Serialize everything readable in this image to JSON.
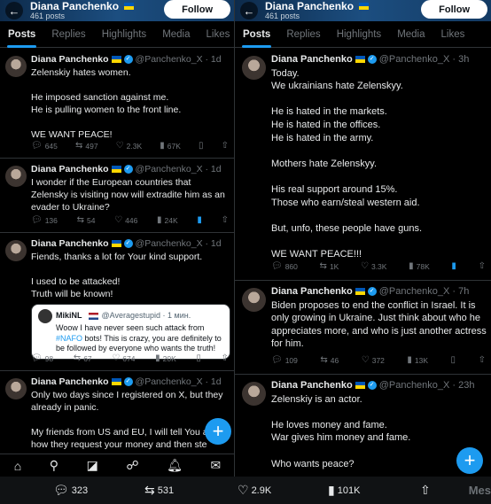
{
  "left": {
    "header": {
      "name": "Diana Panchenko",
      "posts": "461 posts",
      "follow": "Follow"
    },
    "tabs": [
      "Posts",
      "Replies",
      "Highlights",
      "Media",
      "Likes"
    ],
    "tweets": [
      {
        "name": "Diana Panchenko",
        "handle": "@Panchenko_X · 1d",
        "text": "Zelenskiy hates women.\n\nHe imposed sanction against me.\nHe is pulling women to the front line.\n\nWE WANT PEACE!",
        "replies": "645",
        "reposts": "497",
        "likes": "2.3K",
        "views": "67K"
      },
      {
        "name": "Diana Panchenko",
        "handle": "@Panchenko_X · 1d",
        "text": "I wonder if the European countries that Zelensky is visiting now will extradite him as an evader to Ukraine?",
        "replies": "136",
        "reposts": "54",
        "likes": "446",
        "views": "24K"
      },
      {
        "name": "Diana Panchenko",
        "handle": "@Panchenko_X · 1d",
        "text": "Fiends, thanks a lot for Your kind support.\n\nI used to be attacked!\nTruth will be known!",
        "replies": "98",
        "reposts": "67",
        "likes": "674",
        "views": "20K",
        "quote": {
          "name": "MikiNL",
          "handle": "@Averagestupid · 1 мин.",
          "text_a": "Woow I have never seen such attack from",
          "tag": "#NAFO",
          "text_b": " bots! This is crazy, you are definitely to be followed by everyone who wants the truth!"
        }
      },
      {
        "name": "Diana Panchenko",
        "handle": "@Panchenko_X · 1d",
        "text": "Only two days since I registered on X, but they already in panic.\n\nMy friends from US and EU, I will tell You a\nhow they request your money and then ste"
      }
    ]
  },
  "right": {
    "header": {
      "name": "Diana Panchenko",
      "posts": "461 posts",
      "follow": "Follow"
    },
    "tabs": [
      "Posts",
      "Replies",
      "Highlights",
      "Media",
      "Likes"
    ],
    "tweets": [
      {
        "name": "Diana Panchenko",
        "handle": "@Panchenko_X · 3h",
        "text": "Today.\nWe ukrainians hate Zelenskyy.\n\nHe is hated in the markets.\nHe is hated in the offices.\nHe is hated in the army.\n\nMothers hate Zelenskyy.\n\nHis real support around 15%.\nThose who earn/steal western aid.\n\nBut, unfo, these people have guns.\n\nWE WANT PEACE!!!",
        "replies": "860",
        "reposts": "1K",
        "likes": "3.3K",
        "views": "78K"
      },
      {
        "name": "Diana Panchenko",
        "handle": "@Panchenko_X · 7h",
        "text": "Biden proposes to end the conflict in Israel. It is only growing in Ukraine. Just think about who he appreciates more, and who is just another actress for him.",
        "replies": "109",
        "reposts": "46",
        "likes": "372",
        "views": "13K"
      },
      {
        "name": "Diana Panchenko",
        "handle": "@Panchenko_X · 23h",
        "text": "Zelenskiy is an actor.\n\nHe loves money and fame.\nWar gives him money and fame.\n\nWho wants peace?"
      }
    ]
  },
  "bottom_bar": {
    "replies": "323",
    "reposts": "531",
    "likes": "2.9K",
    "views": "101K",
    "ghost": "Mes"
  },
  "icons": {
    "reply": "speech-bubble-icon",
    "repost": "repost-arrows-icon",
    "like": "heart-icon",
    "views": "bar-chart-icon",
    "bookmark": "bookmark-icon",
    "share": "share-icon"
  },
  "colors": {
    "accent": "#1d9bf0",
    "background": "#000000",
    "header_blue": "#1c4e80"
  }
}
